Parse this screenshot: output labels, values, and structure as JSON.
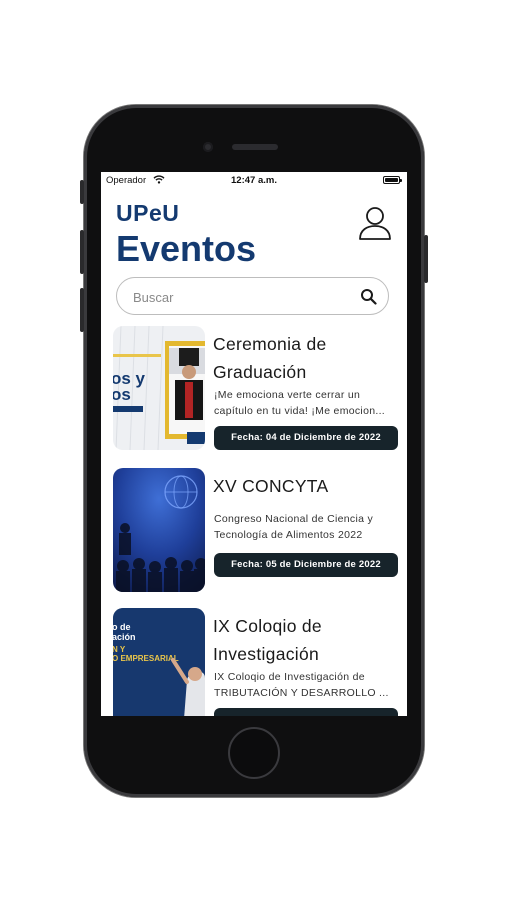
{
  "status_bar": {
    "carrier": "Operador",
    "time": "12:47 a.m."
  },
  "header": {
    "brand": "UPeU",
    "title": "Eventos"
  },
  "search": {
    "placeholder": "Buscar"
  },
  "events": [
    {
      "title": "Ceremonia de Graduación",
      "description": "¡Me emociona verte cerrar un capítulo en tu vida! ¡Me emocion...",
      "date": "Fecha: 04 de Diciembre de 2022",
      "thumb_text": "os y\nos"
    },
    {
      "title": "XV CONCYTA",
      "description": "Congreso Nacional de Ciencia y Tecnología de Alimentos 2022",
      "date": "Fecha: 05 de Diciembre de 2022"
    },
    {
      "title": "IX Coloqio de Investigación",
      "description": "IX Coloqio de Investigación de TRIBUTACIÓN Y DESARROLLO ...",
      "date": "",
      "thumb_text_1": "o de",
      "thumb_text_2": "ación",
      "thumb_text_3": "N Y",
      "thumb_text_4": "O EMPRESARIAL"
    }
  ],
  "colors": {
    "brand": "#143a70",
    "date_badge": "#17242b"
  },
  "icons": {
    "profile": "user-outline-icon",
    "search": "magnifier-icon",
    "wifi": "wifi-icon",
    "battery": "battery-icon"
  }
}
